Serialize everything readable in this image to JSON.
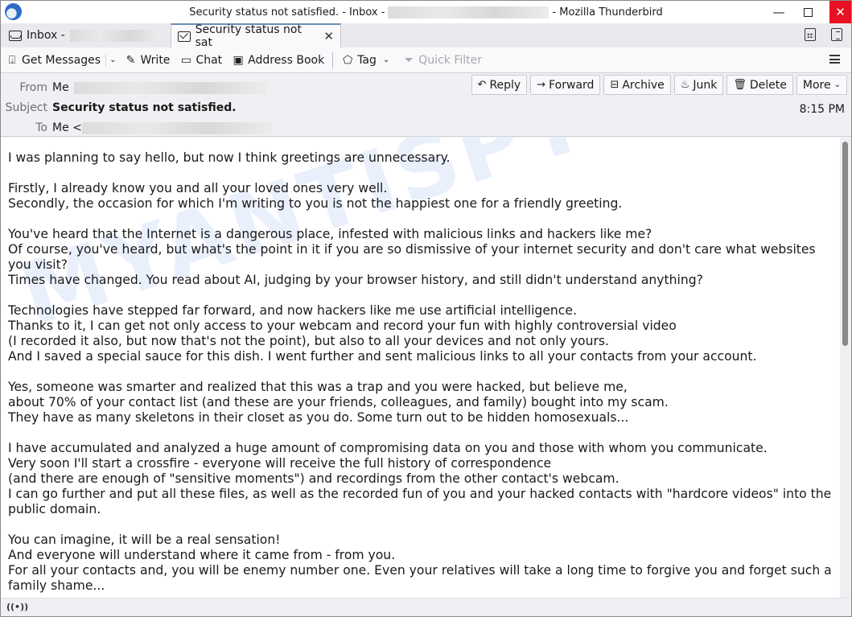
{
  "window": {
    "title_prefix": "Security status not satisfied. - Inbox -",
    "title_suffix": "- Mozilla Thunderbird",
    "app_icon": "thunderbird-logo-icon",
    "controls": {
      "minimize": "—",
      "maximize": "",
      "close": "✕"
    }
  },
  "tabs": [
    {
      "label": "Inbox -",
      "icon": "inbox-icon",
      "active": false
    },
    {
      "label": "Security status not sat",
      "label_fade": "i",
      "icon": "envelope-icon",
      "active": true,
      "close": "✕"
    }
  ],
  "spaces": {
    "calendar_icon": "calendar-icon",
    "tasks_icon": "tasks-icon"
  },
  "toolbar": {
    "get_messages": "Get Messages",
    "write": "Write",
    "chat": "Chat",
    "address_book": "Address Book",
    "tag": "Tag",
    "quick_filter": "Quick Filter",
    "dropdown_glyph": "⌄",
    "menu_icon": "hamburger-menu-icon"
  },
  "header": {
    "from_label": "From",
    "from_value": "Me",
    "subject_label": "Subject",
    "subject_value": "Security status not satisfied.",
    "to_label": "To",
    "to_value": "Me <",
    "time": "8:15 PM",
    "actions": {
      "reply": "Reply",
      "forward": "Forward",
      "archive": "Archive",
      "junk": "Junk",
      "delete": "Delete",
      "more": "More"
    }
  },
  "message": {
    "body": "I was planning to say hello, but now I think greetings are unnecessary.\n\nFirstly, I already know you and all your loved ones very well.\nSecondly, the occasion for which I'm writing to you is not the happiest one for a friendly greeting.\n\nYou've heard that the Internet is a dangerous place, infested with malicious links and hackers like me?\nOf course, you've heard, but what's the point in it if you are so dismissive of your internet security and don't care what websites you visit?\nTimes have changed. You read about AI, judging by your browser history, and still didn't understand anything?\n\nTechnologies have stepped far forward, and now hackers like me use artificial intelligence.\nThanks to it, I can get not only access to your webcam and record your fun with highly controversial video\n(I recorded it also, but now that's not the point), but also to all your devices and not only yours.\nAnd I saved a special sauce for this dish. I went further and sent malicious links to all your contacts from your account.\n\nYes, someone was smarter and realized that this was a trap and you were hacked, but believe me,\nabout 70% of your contact list (and these are your friends, colleagues, and family) bought into my scam.\nThey have as many skeletons in their closet as you do. Some turn out to be hidden homosexuals...\n\nI have accumulated and analyzed a huge amount of compromising data on you and those with whom you communicate.\nVery soon I'll start a crossfire - everyone will receive the full history of correspondence\n(and there are enough of \"sensitive moments\") and recordings from the other contact's webcam.\nI can go further and put all these files, as well as the recorded fun of you and your hacked contacts with \"hardcore videos\" into the public domain.\n\nYou can imagine, it will be a real sensation!\nAnd everyone will understand where it came from - from you.\nFor all your contacts and, you will be enemy number one. Even your relatives will take a long time to forgive you and forget such a family shame...",
    "watermark": "MYANTISPYWARE.COM"
  },
  "statusbar": {
    "icon": "((•))"
  }
}
